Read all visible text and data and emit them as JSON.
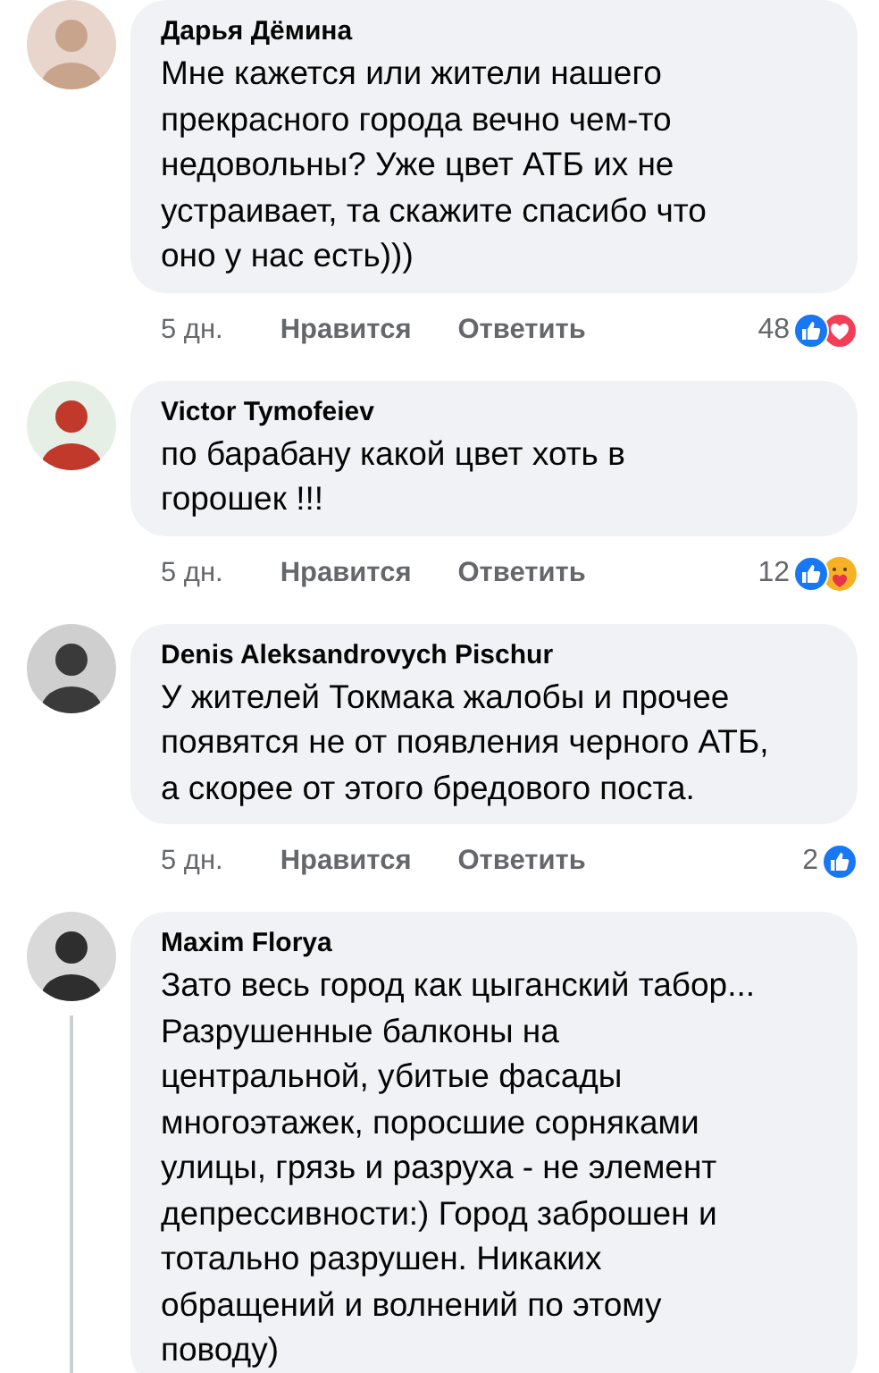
{
  "comments": [
    {
      "author": "Дарья Дёмина",
      "thread_line": false,
      "text": "Мне кажется или жители нашего\nпрекрасного города вечно чем-то\nнедовольны? Уже цвет АТБ их не\nустраивает, та скажите спасибо что\nоно у нас есть)))",
      "meta": {
        "time": "5 дн.",
        "like": "Нравится",
        "reply": "Ответить",
        "count": "48",
        "reactions": [
          {
            "kind": "like"
          },
          {
            "kind": "love"
          }
        ]
      }
    },
    {
      "author": "Victor Tymofeiev",
      "thread_line": false,
      "text": "по барабану какой цвет хоть в\nгорошек !!!",
      "meta": {
        "time": "5 дн.",
        "like": "Нравится",
        "reply": "Ответить",
        "count": "12",
        "reactions": [
          {
            "kind": "like"
          },
          {
            "kind": "care"
          }
        ]
      }
    },
    {
      "author": "Denis Aleksandrovych Pischur",
      "thread_line": false,
      "text": "У жителей Токмака жалобы и прочее\nпоявятся не от появления черного АТБ,\nа скорее от этого бредового поста.",
      "meta": {
        "time": "5 дн.",
        "like": "Нравится",
        "reply": "Ответить",
        "count": "2",
        "reactions": [
          {
            "kind": "like"
          }
        ]
      }
    },
    {
      "author": "Maxim Florya",
      "thread_line": true,
      "text": "Зато весь город как цыганский табор...\nРазрушенные балконы на\nцентральной, убитые фасады\nмногоэтажек, поросшие сорняками\nулицы, грязь и разруха - не элемент\nдепрессивности:) Город заброшен и\nтотально разрушен. Никаких\nобращений и волнений по этому\nповоду)"
    }
  ]
}
